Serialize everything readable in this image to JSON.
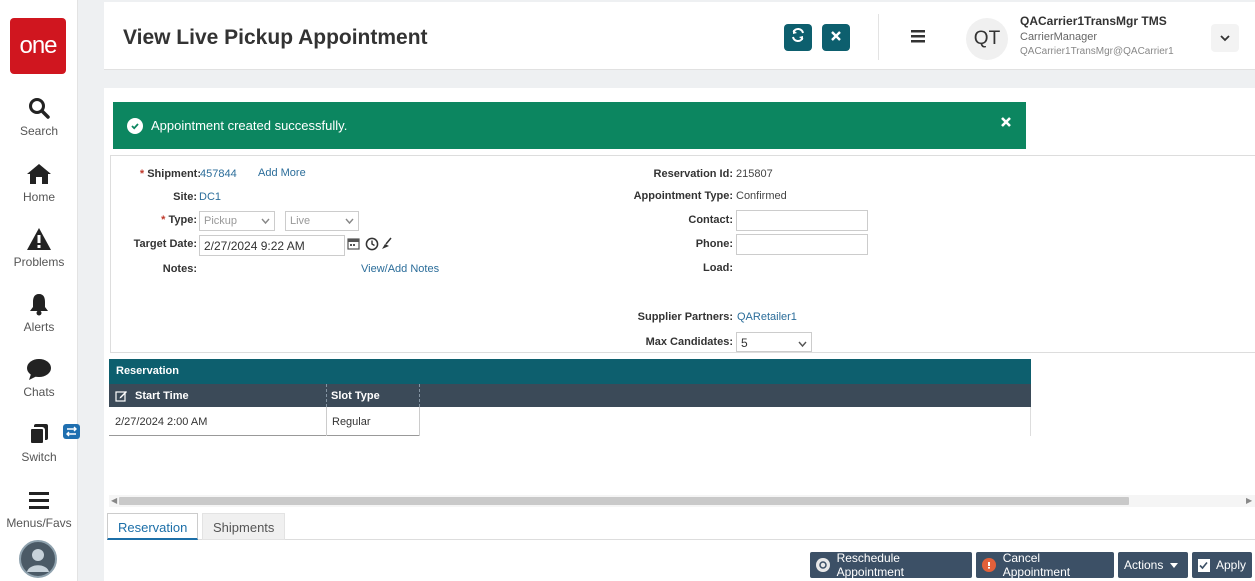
{
  "nav": {
    "logo_text": "one",
    "items": [
      {
        "label": "Search",
        "icon": "search-icon"
      },
      {
        "label": "Home",
        "icon": "home-icon"
      },
      {
        "label": "Problems",
        "icon": "warning-icon"
      },
      {
        "label": "Alerts",
        "icon": "bell-icon"
      },
      {
        "label": "Chats",
        "icon": "chat-icon"
      },
      {
        "label": "Switch",
        "icon": "switch-icon"
      },
      {
        "label": "Menus/Favs",
        "icon": "menu-icon"
      }
    ]
  },
  "header": {
    "title": "View Live Pickup Appointment",
    "user": {
      "initials": "QT",
      "name": "QACarrier1TransMgr TMS",
      "role": "CarrierManager",
      "email": "QACarrier1TransMgr@QACarrier1"
    }
  },
  "toast": {
    "message": "Appointment created successfully.",
    "color": "#0c8660"
  },
  "form": {
    "shipment_label": "Shipment:",
    "shipment_value": "457844",
    "add_more": "Add More",
    "site_label": "Site:",
    "site_value": "DC1",
    "type_label": "Type:",
    "type_value": "Pickup",
    "type2_value": "Live",
    "target_date_label": "Target Date:",
    "target_date_value": "2/27/2024 9:22 AM",
    "notes_label": "Notes:",
    "view_add_notes": "View/Add Notes",
    "reservation_id_label": "Reservation Id:",
    "reservation_id_value": "215807",
    "appointment_type_label": "Appointment Type:",
    "appointment_type_value": "Confirmed",
    "contact_label": "Contact:",
    "contact_value": "",
    "phone_label": "Phone:",
    "phone_value": "",
    "load_label": "Load:",
    "supplier_partners_label": "Supplier Partners:",
    "supplier_partners_value": "QARetailer1",
    "max_candidates_label": "Max Candidates:",
    "max_candidates_value": "5"
  },
  "grid": {
    "title": "Reservation",
    "columns": [
      "Start Time",
      "Slot Type"
    ],
    "rows": [
      {
        "start_time": "2/27/2024 2:00 AM",
        "slot_type": "Regular"
      }
    ]
  },
  "tabs": [
    "Reservation",
    "Shipments"
  ],
  "footer": {
    "reschedule": "Reschedule Appointment",
    "cancel": "Cancel Appointment",
    "actions": "Actions",
    "apply": "Apply"
  },
  "colors": {
    "brand_red": "#d0161f",
    "header_teal": "#0d5f6e",
    "grid_header": "#3b4a58",
    "button_navy": "#3c5066",
    "link_blue": "#2b6d9a"
  }
}
